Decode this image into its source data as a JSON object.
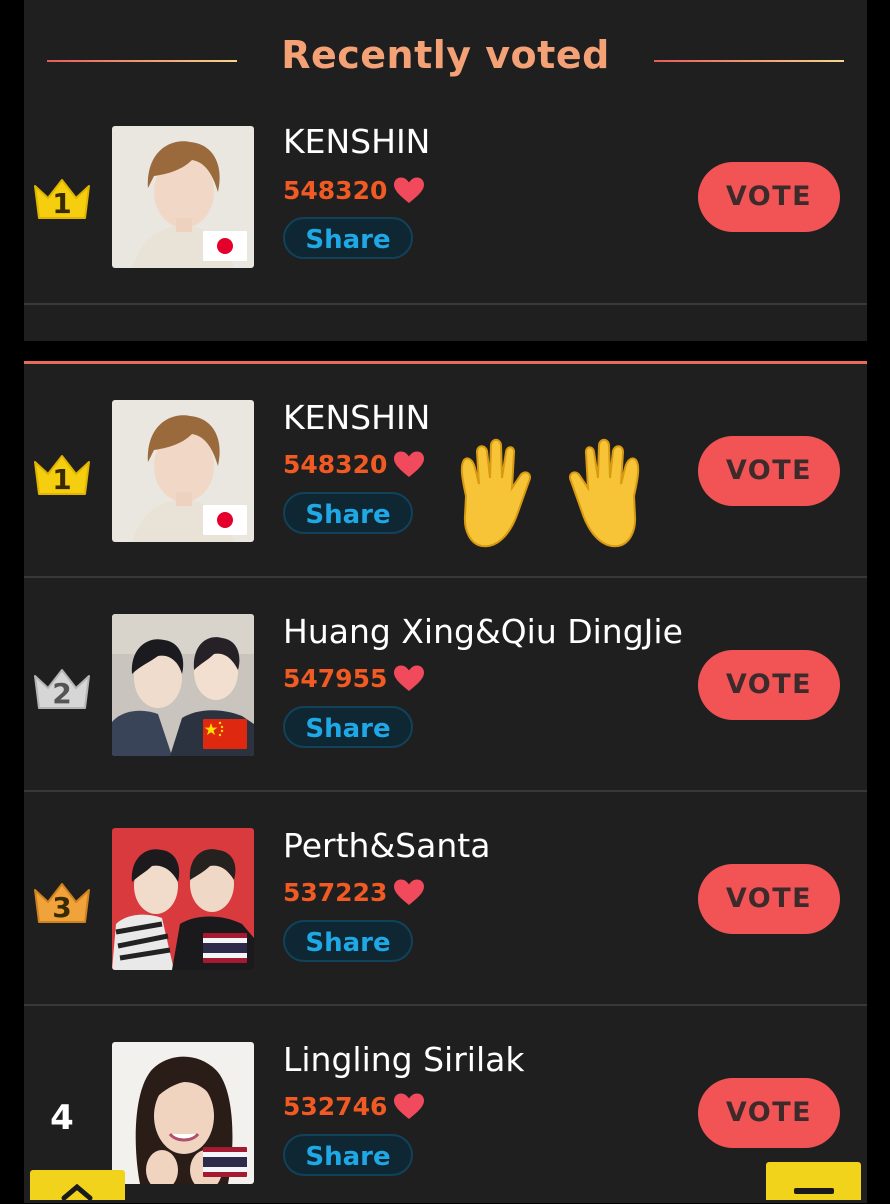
{
  "recent": {
    "title": "Recently voted",
    "entry": {
      "rank": "1",
      "name": "KENSHIN",
      "votes": "548320",
      "share_label": "Share",
      "vote_label": "VOTE",
      "crown": "gold",
      "flag": "japan",
      "photo": "photo-kenshin"
    }
  },
  "ranking": [
    {
      "rank": "1",
      "name": "KENSHIN",
      "votes": "548320",
      "share_label": "Share",
      "vote_label": "VOTE",
      "crown": "gold",
      "flag": "japan",
      "photo": "photo-kenshin"
    },
    {
      "rank": "2",
      "name": "Huang Xing&Qiu DingJie",
      "votes": "547955",
      "share_label": "Share",
      "vote_label": "VOTE",
      "crown": "silver",
      "flag": "china",
      "photo": "photo-huang-xing-qiu-dingjie"
    },
    {
      "rank": "3",
      "name": "Perth&Santa",
      "votes": "537223",
      "share_label": "Share",
      "vote_label": "VOTE",
      "crown": "bronze",
      "flag": "thailand",
      "photo": "photo-perth-santa"
    },
    {
      "rank": "4",
      "name": "Lingling Sirilak",
      "votes": "532746",
      "share_label": "Share",
      "vote_label": "VOTE",
      "crown": "none",
      "flag": "thailand",
      "photo": "photo-lingling-sirilak"
    }
  ],
  "decorations": {
    "hands_emoji": "raised-hands-icon"
  },
  "colors": {
    "accent": "#f4a176",
    "votes": "#f15a22",
    "vote_button": "#f25456",
    "share_text": "#1fa8e6",
    "crown_gold": "#f5cf0f",
    "crown_silver": "#d6d6d6",
    "crown_bronze": "#f0a33a",
    "corner_buttons": "#f2d31c"
  }
}
